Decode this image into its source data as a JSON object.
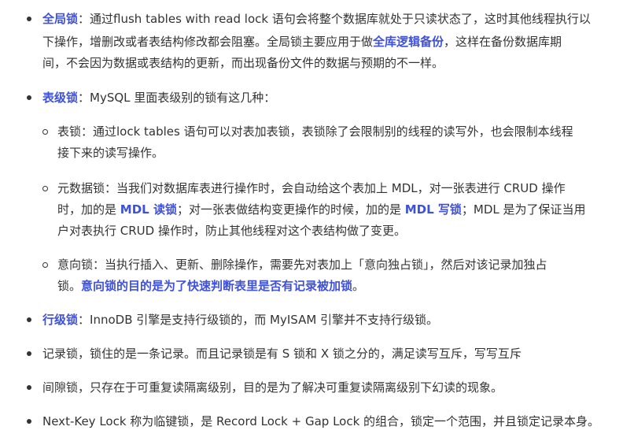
{
  "items": [
    {
      "id": "global-lock",
      "term": "全局锁",
      "sep": "：",
      "lines": [
        "通过flush tables with read lock 语句会将整个数据库就处于只读状态了，这时其他线程执行以",
        "下操作，增删改或者表结构修改都会阻塞。全局锁主要应用于做",
        "间，不会因为数据或表结构的更新，而出现备份文件的数据与预期的不一样。"
      ],
      "highlight": "全库逻辑备份",
      "after_highlight": "，这样在备份数据库期"
    },
    {
      "id": "table-lock",
      "term": "表级锁",
      "sep": "：",
      "text": "MySQL 里面表级别的锁有这几种：",
      "sub": [
        {
          "lines": [
            "表锁：通过lock tables 语句可以对表加表锁，表锁除了会限制别的线程的读写外，也会限制本线程",
            "接下来的读写操作。"
          ]
        },
        {
          "line1": "元数据锁：当我们对数据库表进行操作时，会自动给这个表加上 MDL，对一张表进行 CRUD 操作",
          "line2_a": "时，加的是 ",
          "line2_h1": "MDL 读锁",
          "line2_b": "；对一张表做结构变更操作的时候，加的是 ",
          "line2_h2": "MDL 写锁",
          "line2_c": "；MDL 是为了保证当用",
          "line3": "户对表执行 CRUD 操作时，防止其他线程对这个表结构做了变更。"
        },
        {
          "line1": "意向锁：当执行插入、更新、删除操作，需要先对表加上「意向独占锁」，然后对该记录加独占",
          "line2_a": "锁。",
          "line2_h": "意向锁的目的是为了快速判断表里是否有记录被加锁",
          "line2_b": "。"
        }
      ]
    },
    {
      "id": "row-lock",
      "term": "行级锁",
      "sep": "：",
      "text": "InnoDB 引擎是支持行级锁的，而 MyISAM 引擎并不支持行级锁。"
    },
    {
      "id": "record-lock",
      "text": "记录锁，锁住的是一条记录。而且记录锁是有 S 锁和 X 锁之分的，满足读写互斥，写写互斥"
    },
    {
      "id": "gap-lock",
      "text": "间隙锁，只存在于可重复读隔离级别，目的是为了解决可重复读隔离级别下幻读的现象。"
    },
    {
      "id": "next-key-lock",
      "text": "Next-Key Lock 称为临键锁，是 Record Lock + Gap Lock 的组合，锁定一个范围，并且锁定记录本身。"
    }
  ],
  "colors": {
    "text": "#333333",
    "highlight": "#3f51d8",
    "background": "#ffffff"
  }
}
